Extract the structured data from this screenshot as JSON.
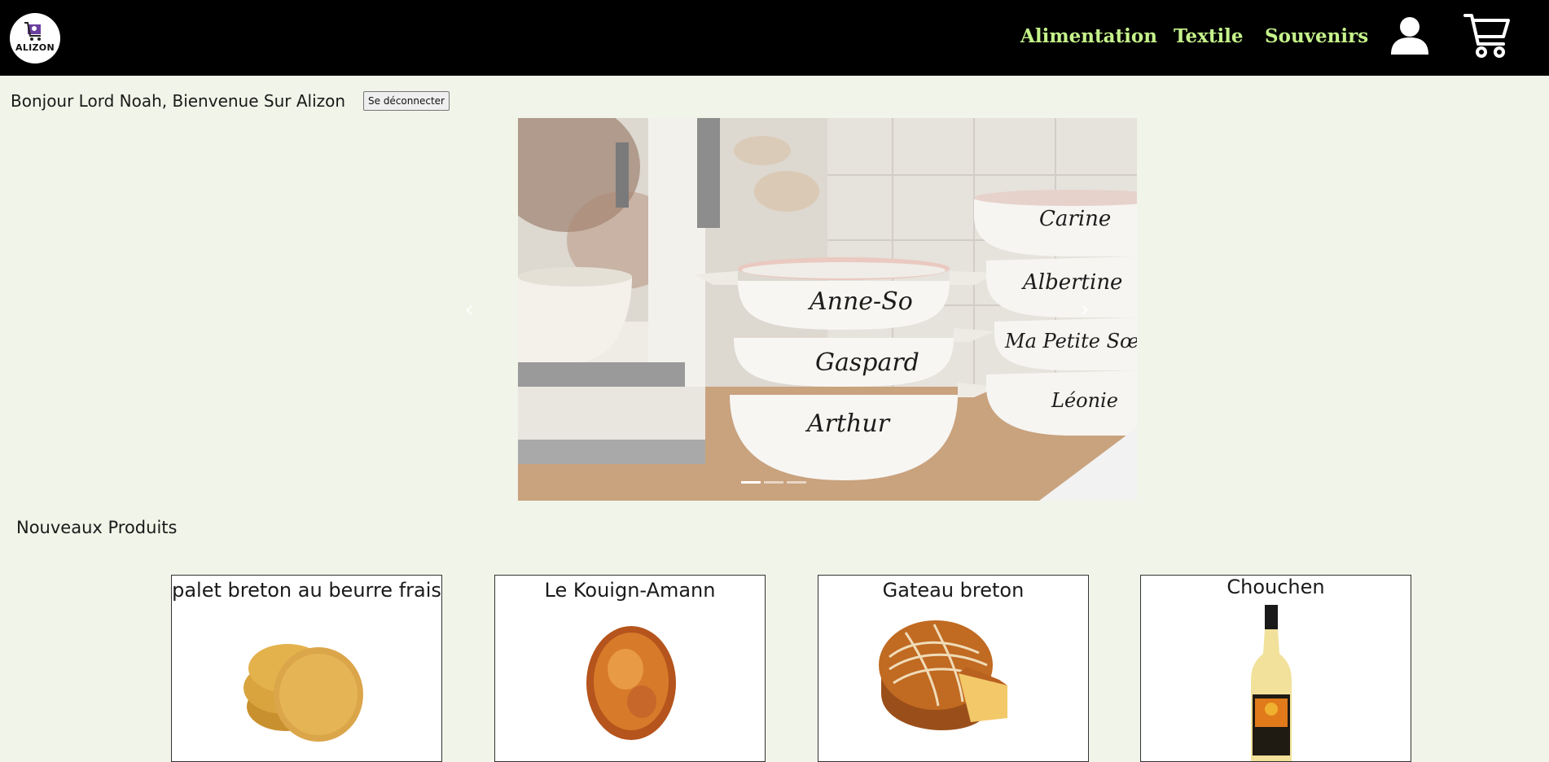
{
  "header": {
    "logo_text": "ALIZON",
    "nav": [
      {
        "label": "Alimentation"
      },
      {
        "label": "Textile"
      },
      {
        "label": "Souvenirs"
      }
    ],
    "account_icon": "user-icon",
    "cart_icon": "shopping-cart-icon"
  },
  "welcome": {
    "message": "Bonjour Lord Noah, Bienvenue Sur Alizon",
    "logout_label": "Se déconnecter"
  },
  "carousel": {
    "prev_symbol": "‹",
    "next_symbol": "›",
    "slide_count": 3,
    "active_index": 0,
    "bowl_names": [
      "Anne-So",
      "Gaspard",
      "Arthur",
      "Carine",
      "Albertine",
      "Ma Petite Sœur",
      "Léonie"
    ]
  },
  "new_products": {
    "title": "Nouveaux Produits",
    "items": [
      {
        "name": "palet breton au beurre frais"
      },
      {
        "name": "Le Kouign-Amann"
      },
      {
        "name": "Gateau breton"
      },
      {
        "name": "Chouchen"
      }
    ]
  },
  "colors": {
    "page_bg": "#f1f4e8",
    "header_bg": "#000000",
    "nav_link": "#c5f28a"
  }
}
